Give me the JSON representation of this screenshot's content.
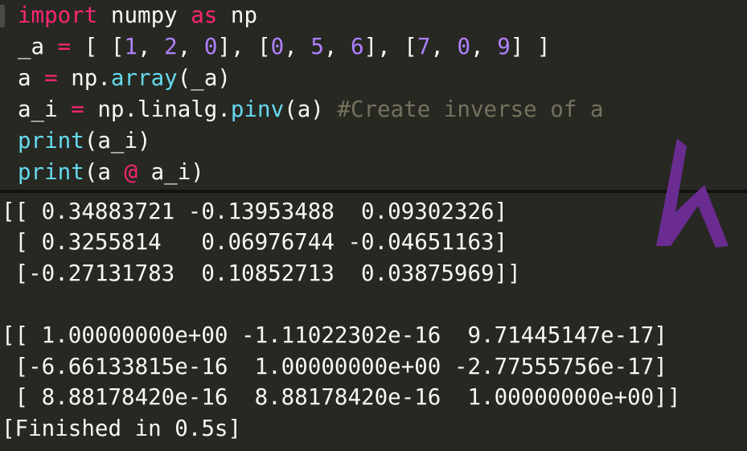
{
  "editor": {
    "lines": [
      [
        {
          "t": "import",
          "c": "kw"
        },
        {
          "t": " numpy ",
          "c": "tx"
        },
        {
          "t": "as",
          "c": "kw"
        },
        {
          "t": " np",
          "c": "tx"
        }
      ],
      [
        {
          "t": "_a ",
          "c": "tx"
        },
        {
          "t": "=",
          "c": "kw"
        },
        {
          "t": " [ [",
          "c": "tx"
        },
        {
          "t": "1",
          "c": "num"
        },
        {
          "t": ", ",
          "c": "tx"
        },
        {
          "t": "2",
          "c": "num"
        },
        {
          "t": ", ",
          "c": "tx"
        },
        {
          "t": "0",
          "c": "num"
        },
        {
          "t": "], [",
          "c": "tx"
        },
        {
          "t": "0",
          "c": "num"
        },
        {
          "t": ", ",
          "c": "tx"
        },
        {
          "t": "5",
          "c": "num"
        },
        {
          "t": ", ",
          "c": "tx"
        },
        {
          "t": "6",
          "c": "num"
        },
        {
          "t": "], [",
          "c": "tx"
        },
        {
          "t": "7",
          "c": "num"
        },
        {
          "t": ", ",
          "c": "tx"
        },
        {
          "t": "0",
          "c": "num"
        },
        {
          "t": ", ",
          "c": "tx"
        },
        {
          "t": "9",
          "c": "num"
        },
        {
          "t": "] ]",
          "c": "tx"
        }
      ],
      [
        {
          "t": "a ",
          "c": "tx"
        },
        {
          "t": "=",
          "c": "kw"
        },
        {
          "t": " np.",
          "c": "tx"
        },
        {
          "t": "array",
          "c": "fn"
        },
        {
          "t": "(_a)",
          "c": "tx"
        }
      ],
      [
        {
          "t": "a_i ",
          "c": "tx"
        },
        {
          "t": "=",
          "c": "kw"
        },
        {
          "t": " np.linalg.",
          "c": "tx"
        },
        {
          "t": "pinv",
          "c": "fn"
        },
        {
          "t": "(a) ",
          "c": "tx"
        },
        {
          "t": "#Create inverse of a",
          "c": "cm"
        }
      ],
      [
        {
          "t": "print",
          "c": "fn"
        },
        {
          "t": "(a_i)",
          "c": "tx"
        }
      ],
      [
        {
          "t": "print",
          "c": "fn"
        },
        {
          "t": "(a ",
          "c": "tx"
        },
        {
          "t": "@",
          "c": "kw"
        },
        {
          "t": " a_i)",
          "c": "tx"
        }
      ]
    ]
  },
  "output": {
    "lines": [
      "[[ 0.34883721 -0.13953488  0.09302326]",
      " [ 0.3255814   0.06976744 -0.04651163]",
      " [-0.27131783  0.10852713  0.03875969]]",
      "",
      "[[ 1.00000000e+00 -1.11022302e-16  9.71445147e-17]",
      " [-6.66133815e-16  1.00000000e+00 -2.77555756e-17]",
      " [ 8.88178420e-16  8.88178420e-16  1.00000000e+00]]",
      "[Finished in 0.5s]"
    ]
  },
  "logo": {
    "icon": "k-logo-icon",
    "color": "#6a2c91"
  },
  "colors": {
    "background": "#272822",
    "keyword": "#f92672",
    "number": "#ae81ff",
    "function": "#66d9ef",
    "comment": "#75715e",
    "text": "#f8f8f2"
  }
}
